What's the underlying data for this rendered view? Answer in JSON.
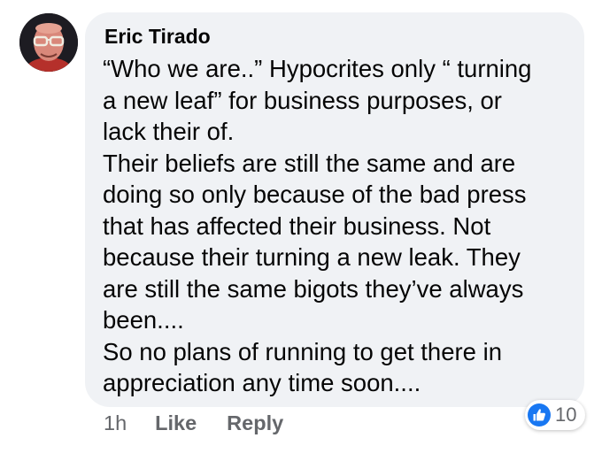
{
  "comment": {
    "author": "Eric Tirado",
    "lines": [
      "“Who we are..” Hypocrites only “ turning",
      "a new leaf” for business purposes, or",
      "lack their of.",
      "Their beliefs are still the same and are",
      "doing so only because of the bad press",
      "that has affected their business. Not",
      "because their turning a new leak. They",
      "are still the same bigots they’ve always",
      "been....",
      "So no plans of running to get there in",
      "appreciation any time soon...."
    ],
    "timestamp": "1h",
    "like_label": "Like",
    "reply_label": "Reply",
    "reaction_count": "10",
    "reaction_icon": "thumbs-up-icon"
  },
  "colors": {
    "bubble": "#f0f2f5",
    "text": "#050505",
    "meta": "#65676b",
    "like_blue": "#1877f2"
  }
}
